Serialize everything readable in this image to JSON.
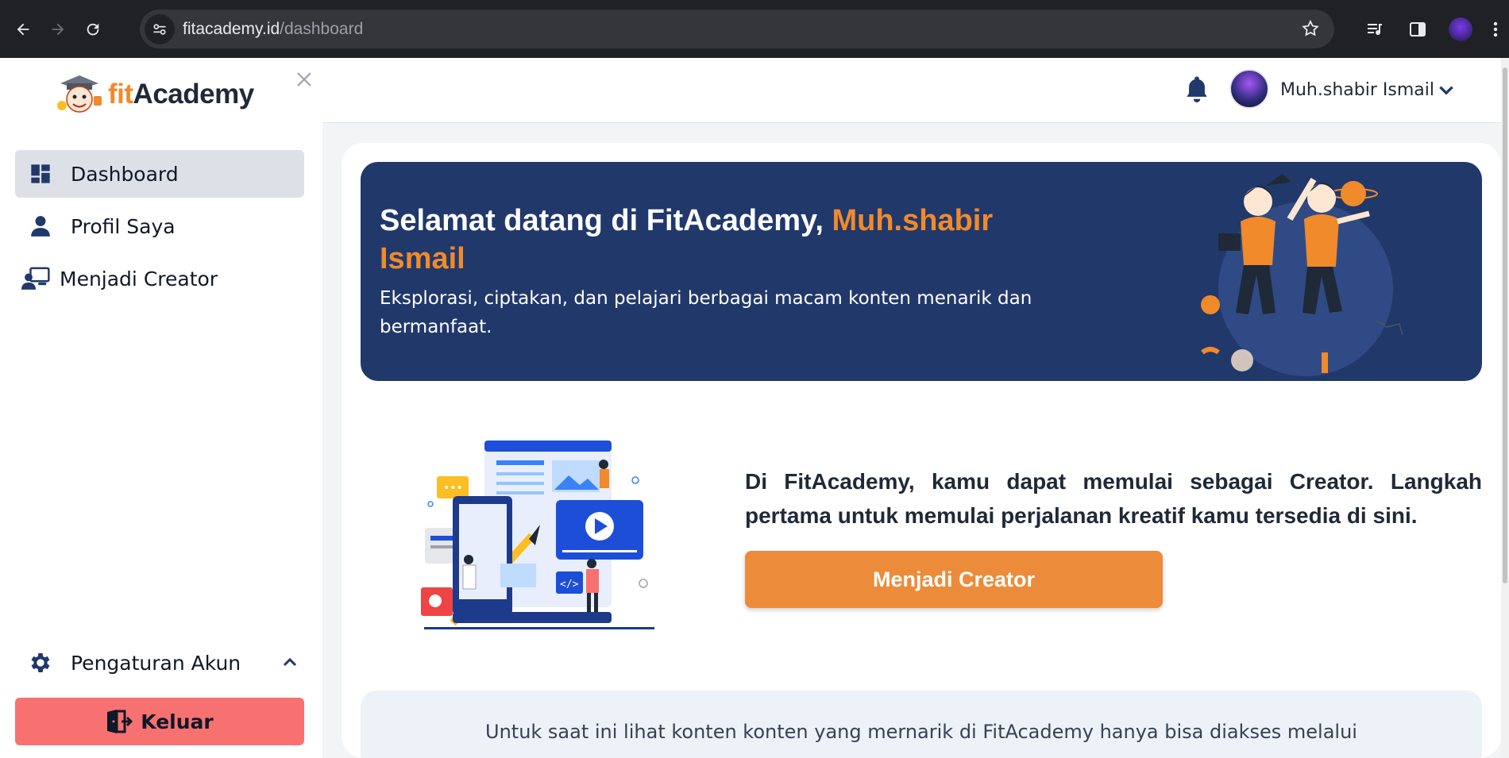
{
  "browser": {
    "url_host": "fitacademy.id",
    "url_path": "/dashboard"
  },
  "sidebar": {
    "brand_prefix": "fit",
    "brand_suffix": "Academy",
    "items": [
      {
        "label": "Dashboard",
        "icon": "dashboard-icon",
        "active": true
      },
      {
        "label": "Profil Saya",
        "icon": "user-icon",
        "active": false
      },
      {
        "label": "Menjadi Creator",
        "icon": "creator-icon",
        "active": false
      }
    ],
    "settings_label": "Pengaturan Akun",
    "logout_label": "Keluar"
  },
  "topbar": {
    "user_name": "Muh.shabir Ismail"
  },
  "hero": {
    "title_prefix": "Selamat datang di FitAcademy, ",
    "title_name": "Muh.shabir Ismail",
    "subtitle": "Eksplorasi, ciptakan, dan pelajari berbagai macam konten menarik dan bermanfaat."
  },
  "creator": {
    "text": "Di FitAcademy, kamu dapat memulai sebagai Creator. Langkah pertama untuk memulai perjalanan kreatif kamu tersedia di sini.",
    "button_label": "Menjadi Creator"
  },
  "info": {
    "text": "Untuk saat ini lihat konten konten yang mernarik di FitAcademy hanya bisa diakses melalui"
  },
  "colors": {
    "accent_orange": "#ec8b3a",
    "hero_navy": "#21386b",
    "logout_red": "#f87171"
  }
}
